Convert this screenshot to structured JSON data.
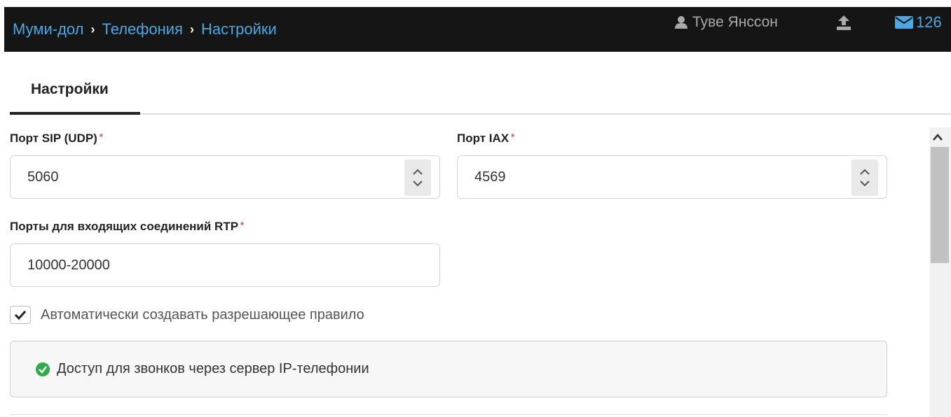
{
  "header": {
    "breadcrumb": [
      "Муми-дол",
      "Телефония",
      "Настройки"
    ],
    "separator": "›",
    "user_name": "Туве Янссон",
    "user_icon": "user-icon",
    "upload_icon": "upload-icon",
    "mail_icon": "mail-icon",
    "mail_count": "126"
  },
  "tabs": [
    {
      "label": "Настройки",
      "active": true
    }
  ],
  "form": {
    "sip_port": {
      "label": "Порт SIP (UDP)",
      "required_mark": "*",
      "value": "5060"
    },
    "iax_port": {
      "label": "Порт IAX",
      "required_mark": "*",
      "value": "4569"
    },
    "rtp_ports": {
      "label": "Порты для входящих соединений RTP",
      "required_mark": "*",
      "value": "10000-20000"
    },
    "auto_rule": {
      "label": "Автоматически создавать разрешающее правило",
      "checked": true
    },
    "access_notice": {
      "text": "Доступ для звонков через сервер IP-телефонии",
      "icon": "check-circle-icon"
    }
  },
  "colors": {
    "topbar_bg": "#151515",
    "link": "#4ea6e3",
    "required": "#d9534f",
    "success": "#2eaa4a"
  }
}
